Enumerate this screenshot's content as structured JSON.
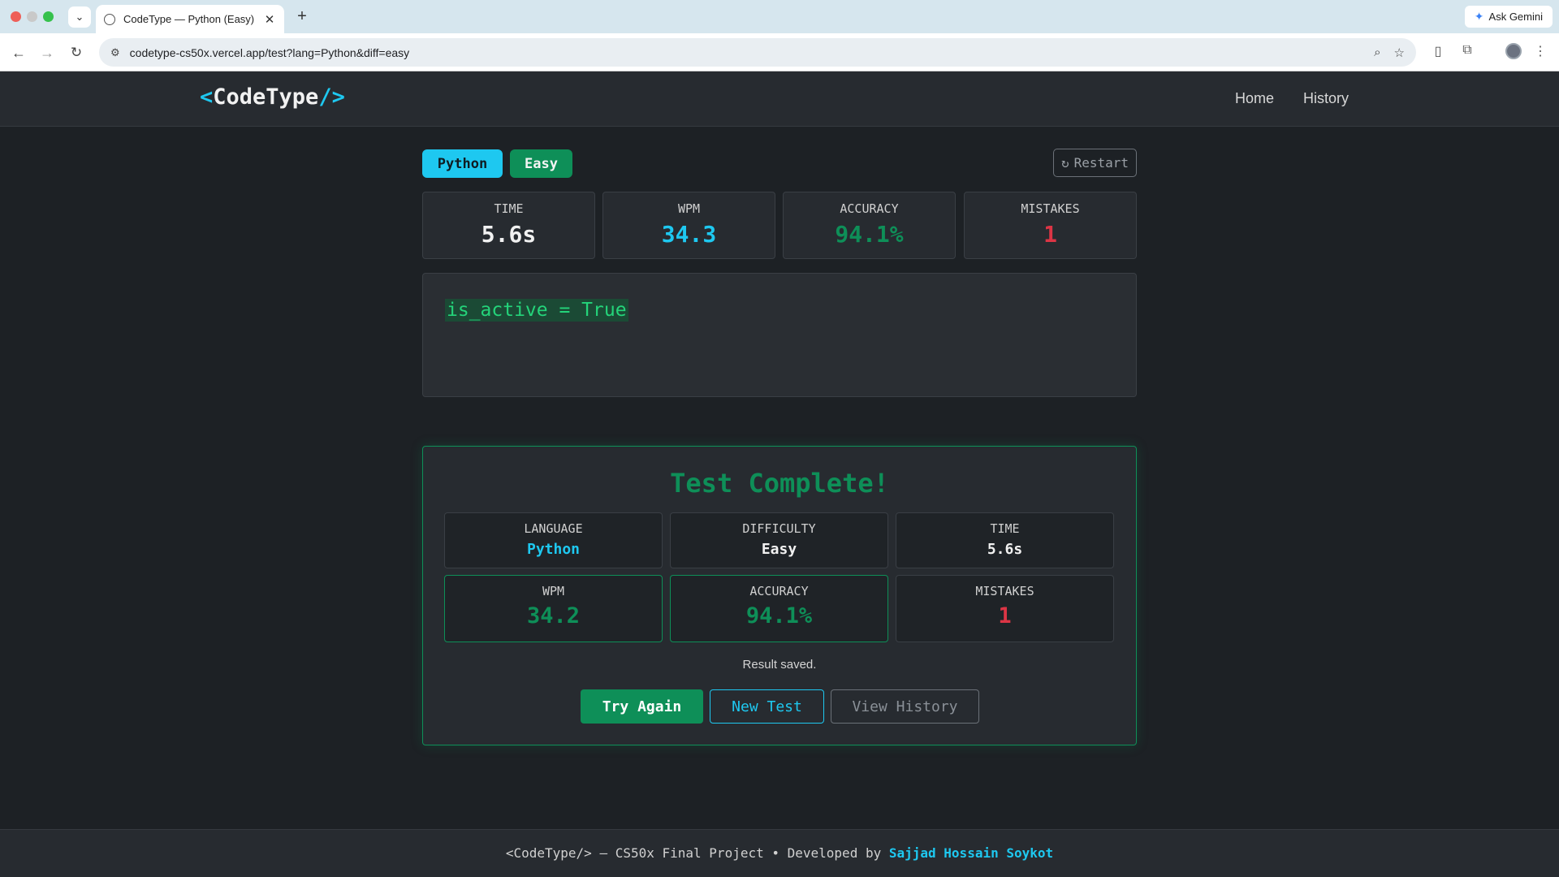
{
  "browser": {
    "tab_title": "CodeType — Python (Easy)",
    "url": "codetype-cs50x.vercel.app/test?lang=Python&diff=easy",
    "gemini_label": "Ask Gemini"
  },
  "header": {
    "logo_open": "<",
    "logo_name": "CodeType",
    "logo_close": "/>",
    "nav": [
      "Home",
      "History"
    ]
  },
  "test": {
    "language": "Python",
    "difficulty": "Easy",
    "restart_label": "Restart",
    "stats": [
      {
        "label": "TIME",
        "value": "5.6s",
        "color": "#f1f1f1"
      },
      {
        "label": "WPM",
        "value": "34.3",
        "color": "#1ec8f0"
      },
      {
        "label": "ACCURACY",
        "value": "94.1%",
        "color": "#0e8f58"
      },
      {
        "label": "MISTAKES",
        "value": "1",
        "color": "#dc3545"
      }
    ],
    "code": "is_active = True"
  },
  "result": {
    "title": "Test Complete!",
    "cards": [
      {
        "label": "LANGUAGE",
        "value": "Python",
        "color": "#1ec8f0"
      },
      {
        "label": "DIFFICULTY",
        "value": "Easy",
        "color": "#f1f1f1"
      },
      {
        "label": "TIME",
        "value": "5.6s",
        "color": "#f1f1f1"
      },
      {
        "label": "WPM",
        "value": "34.2",
        "color": "#0e8f58"
      },
      {
        "label": "ACCURACY",
        "value": "94.1%",
        "color": "#0e8f58"
      },
      {
        "label": "MISTAKES",
        "value": "1",
        "color": "#dc3545"
      }
    ],
    "saved_text": "Result saved.",
    "buttons": {
      "try_again": "Try Again",
      "new_test": "New Test",
      "view_history": "View History"
    }
  },
  "footer": {
    "prefix": "<CodeType/> — CS50x Final Project • Developed by",
    "author": "Sajjad Hossain Soykot"
  },
  "colors": {
    "accent_cyan": "#1ec8f0",
    "accent_green": "#0e8f58",
    "error_red": "#dc3545"
  }
}
